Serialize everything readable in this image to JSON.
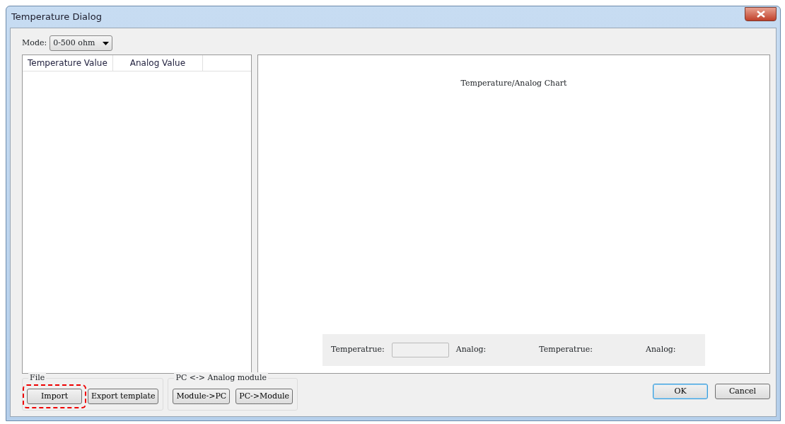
{
  "window": {
    "title": "Temperature Dialog"
  },
  "mode": {
    "label": "Mode:",
    "value": "0-500 ohm"
  },
  "table": {
    "columns": [
      "Temperature Value",
      "Analog Value"
    ]
  },
  "chart": {
    "title": "Temperature/Analog Chart"
  },
  "readout": [
    {
      "kind": "label",
      "text": "Temperatrue:"
    },
    {
      "kind": "field"
    },
    {
      "kind": "label",
      "text": "Analog:"
    },
    {
      "kind": "spacer"
    },
    {
      "kind": "label",
      "text": "Temperatrue:"
    },
    {
      "kind": "spacer"
    },
    {
      "kind": "label",
      "text": "Analog:"
    }
  ],
  "groups": [
    {
      "title": "File",
      "buttons": [
        {
          "label": "Import",
          "highlighted": true
        },
        {
          "label": "Export template",
          "highlighted": false
        }
      ]
    },
    {
      "title": "PC <-> Analog module",
      "buttons": [
        {
          "label": "Module->PC",
          "highlighted": false
        },
        {
          "label": "PC->Module",
          "highlighted": false
        }
      ]
    }
  ],
  "dialog_buttons": [
    {
      "label": "OK",
      "default": true
    },
    {
      "label": "Cancel",
      "default": false
    }
  ]
}
